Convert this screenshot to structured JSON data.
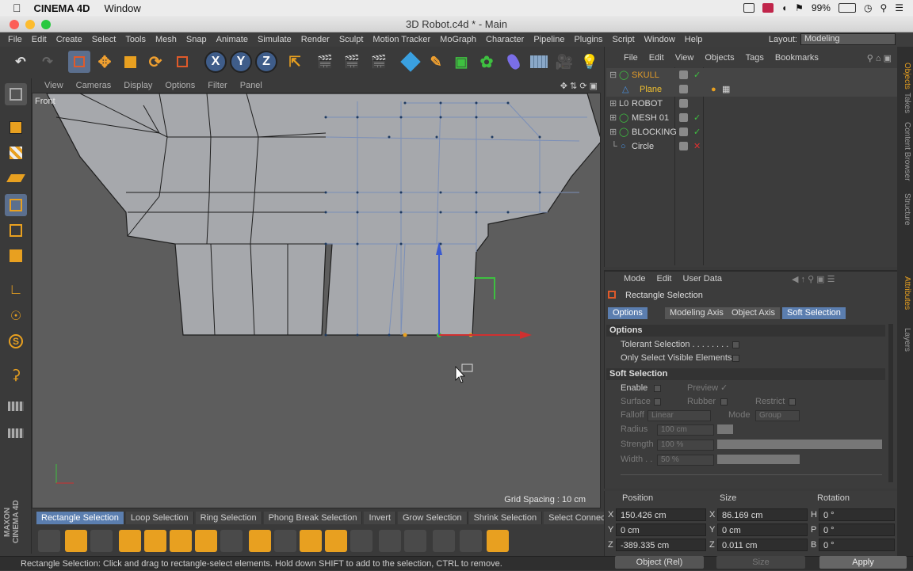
{
  "macbar": {
    "app": "CINEMA 4D",
    "window_menu": "Window",
    "battery": "99%"
  },
  "window": {
    "title": "3D Robot.c4d * - Main"
  },
  "menu": {
    "items": [
      "File",
      "Edit",
      "Create",
      "Select",
      "Tools",
      "Mesh",
      "Snap",
      "Animate",
      "Simulate",
      "Render",
      "Sculpt",
      "Motion Tracker",
      "MoGraph",
      "Character",
      "Pipeline",
      "Plugins",
      "Script",
      "Window",
      "Help"
    ],
    "layout_label": "Layout:",
    "layout_value": "Modeling"
  },
  "viewport": {
    "menu": [
      "View",
      "Cameras",
      "Display",
      "Options",
      "Filter",
      "Panel"
    ],
    "camera_label": "Front",
    "grid_spacing": "Grid Spacing : 10 cm"
  },
  "selection_bar": {
    "items": [
      "Rectangle Selection",
      "Loop Selection",
      "Ring Selection",
      "Phong Break Selection",
      "Invert",
      "Grow Selection",
      "Shrink Selection",
      "Select Connected"
    ],
    "active_index": 0
  },
  "status": "Rectangle Selection: Click and drag to rectangle-select elements. Hold down SHIFT to add to the selection, CTRL to remove.",
  "maxon": "MAXON CINEMA 4D",
  "object_manager": {
    "menu": [
      "File",
      "Edit",
      "View",
      "Objects",
      "Tags",
      "Bookmarks"
    ],
    "objects": [
      {
        "name": "SKULL",
        "color": "#e09a2a"
      },
      {
        "name": "Plane",
        "color": "#f0c030"
      },
      {
        "name": "ROBOT",
        "color": "#d8d8d8"
      },
      {
        "name": "MESH 01",
        "color": "#d8d8d8"
      },
      {
        "name": "BLOCKING",
        "color": "#d8d8d8"
      },
      {
        "name": "Circle",
        "color": "#d8d8d8"
      }
    ]
  },
  "side_tabs": [
    "Objects",
    "Takes",
    "Content Browser",
    "Structure",
    "Attributes",
    "Layers"
  ],
  "attributes": {
    "menu": [
      "Mode",
      "Edit",
      "User Data"
    ],
    "tool_name": "Rectangle Selection",
    "tabs": [
      "Options",
      "Modeling Axis",
      "Object Axis",
      "Soft Selection"
    ],
    "sections": {
      "options": "Options",
      "soft": "Soft Selection"
    },
    "tolerant": "Tolerant Selection . . . . . . . .",
    "visible_only": "Only Select Visible Elements",
    "enable": "Enable",
    "preview": "Preview",
    "surface": "Surface",
    "rubber": "Rubber",
    "restrict": "Restrict",
    "falloff": "Falloff",
    "falloff_value": "Linear",
    "mode": "Mode",
    "mode_value": "Group",
    "radius": "Radius",
    "radius_value": "100 cm",
    "strength": "Strength",
    "strength_value": "100 %",
    "width": "Width . .",
    "width_value": "50 %"
  },
  "coordinates": {
    "headers": [
      "Position",
      "Size",
      "Rotation"
    ],
    "x_pos": "150.426 cm",
    "y_pos": "0 cm",
    "z_pos": "-389.335 cm",
    "x_size": "86.169 cm",
    "y_size": "0 cm",
    "z_size": "0.011 cm",
    "h": "0 °",
    "p": "0 °",
    "b": "0 °",
    "axis_labels": [
      "X",
      "Y",
      "Z"
    ],
    "rot_labels": [
      "H",
      "P",
      "B"
    ],
    "mode": "Object (Rel)",
    "size_mode": "Size",
    "apply": "Apply"
  }
}
